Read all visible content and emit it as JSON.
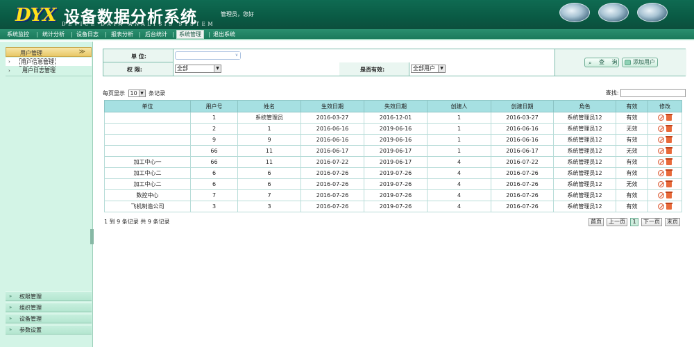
{
  "header": {
    "logo_mark": "DYX",
    "title": "设备数据分析系统",
    "subtitle": "DEVICE DATA ANALYSIS SYSTEM",
    "welcome": "管理员，您好"
  },
  "nav": {
    "items": [
      "系统监控",
      "统计分析",
      "设备日志",
      "报表分析",
      "后台统计",
      "系统管理",
      "退出系统"
    ],
    "active": "系统管理"
  },
  "sidebar": {
    "group_title": "用户管理",
    "group_arrow": "≫",
    "sub_items": [
      "用户信息管理",
      "用户日志管理"
    ],
    "bottom_items": [
      "权限管理",
      "组织管理",
      "设备管理",
      "参数设置"
    ]
  },
  "search": {
    "unit_label": "单 位:",
    "unit_value": "",
    "perm_label": "权 限:",
    "perm_value": "全部",
    "valid_label": "是否有效:",
    "valid_value": "全部用户",
    "query_button": "查 询",
    "add_button": "添加用户"
  },
  "table": {
    "page_size_prefix": "每页显示",
    "page_size": "10",
    "page_size_suffix": "条记录",
    "find_label": "查找:",
    "columns": [
      "单位",
      "用户号",
      "姓名",
      "生效日期",
      "失效日期",
      "创建人",
      "创建日期",
      "角色",
      "有效",
      "修改"
    ],
    "rows": [
      [
        "",
        "1",
        "系统管理员",
        "2016-03-27",
        "2016-12-01",
        "1",
        "2016-03-27",
        "系统管理员12",
        "有效"
      ],
      [
        "",
        "2",
        "1",
        "2016-06-16",
        "2019-06-16",
        "1",
        "2016-06-16",
        "系统管理员12",
        "无效"
      ],
      [
        "",
        "9",
        "9",
        "2016-06-16",
        "2019-06-16",
        "1",
        "2016-06-16",
        "系统管理员12",
        "有效"
      ],
      [
        "",
        "66",
        "11",
        "2016-06-17",
        "2019-06-17",
        "1",
        "2016-06-17",
        "系统管理员12",
        "无效"
      ],
      [
        "加工中心一",
        "66",
        "11",
        "2016-07-22",
        "2019-06-17",
        "4",
        "2016-07-22",
        "系统管理员12",
        "有效"
      ],
      [
        "加工中心二",
        "6",
        "6",
        "2016-07-26",
        "2019-07-26",
        "4",
        "2016-07-26",
        "系统管理员12",
        "有效"
      ],
      [
        "加工中心二",
        "6",
        "6",
        "2016-07-26",
        "2019-07-26",
        "4",
        "2016-07-26",
        "系统管理员12",
        "无效"
      ],
      [
        "数控中心",
        "7",
        "7",
        "2016-07-26",
        "2019-07-26",
        "4",
        "2016-07-26",
        "系统管理员12",
        "有效"
      ],
      [
        "飞机制造公司",
        "3",
        "3",
        "2016-07-26",
        "2019-07-26",
        "4",
        "2016-07-26",
        "系统管理员12",
        "有效"
      ]
    ],
    "summary": "1 到 9 条记录 共 9 条记录"
  },
  "pager": {
    "first": "首页",
    "prev": "上一页",
    "current": "1",
    "next": "下一页",
    "last": "末页"
  },
  "colors": {
    "header_green": "#0f6b52",
    "sidebar_bg": "#d3f4e6",
    "table_header": "#a6e0e2"
  }
}
